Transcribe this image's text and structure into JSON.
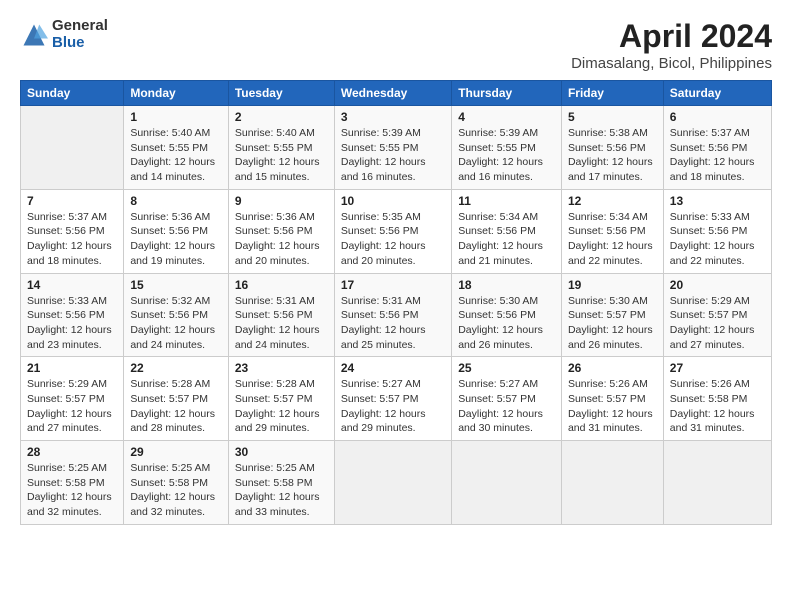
{
  "logo": {
    "general": "General",
    "blue": "Blue"
  },
  "title": "April 2024",
  "subtitle": "Dimasalang, Bicol, Philippines",
  "header": {
    "days": [
      "Sunday",
      "Monday",
      "Tuesday",
      "Wednesday",
      "Thursday",
      "Friday",
      "Saturday"
    ]
  },
  "weeks": [
    [
      {
        "num": "",
        "sunrise": "",
        "sunset": "",
        "daylight": "",
        "empty": true
      },
      {
        "num": "1",
        "sunrise": "Sunrise: 5:40 AM",
        "sunset": "Sunset: 5:55 PM",
        "daylight": "Daylight: 12 hours and 14 minutes.",
        "empty": false
      },
      {
        "num": "2",
        "sunrise": "Sunrise: 5:40 AM",
        "sunset": "Sunset: 5:55 PM",
        "daylight": "Daylight: 12 hours and 15 minutes.",
        "empty": false
      },
      {
        "num": "3",
        "sunrise": "Sunrise: 5:39 AM",
        "sunset": "Sunset: 5:55 PM",
        "daylight": "Daylight: 12 hours and 16 minutes.",
        "empty": false
      },
      {
        "num": "4",
        "sunrise": "Sunrise: 5:39 AM",
        "sunset": "Sunset: 5:55 PM",
        "daylight": "Daylight: 12 hours and 16 minutes.",
        "empty": false
      },
      {
        "num": "5",
        "sunrise": "Sunrise: 5:38 AM",
        "sunset": "Sunset: 5:56 PM",
        "daylight": "Daylight: 12 hours and 17 minutes.",
        "empty": false
      },
      {
        "num": "6",
        "sunrise": "Sunrise: 5:37 AM",
        "sunset": "Sunset: 5:56 PM",
        "daylight": "Daylight: 12 hours and 18 minutes.",
        "empty": false
      }
    ],
    [
      {
        "num": "7",
        "sunrise": "Sunrise: 5:37 AM",
        "sunset": "Sunset: 5:56 PM",
        "daylight": "Daylight: 12 hours and 18 minutes.",
        "empty": false
      },
      {
        "num": "8",
        "sunrise": "Sunrise: 5:36 AM",
        "sunset": "Sunset: 5:56 PM",
        "daylight": "Daylight: 12 hours and 19 minutes.",
        "empty": false
      },
      {
        "num": "9",
        "sunrise": "Sunrise: 5:36 AM",
        "sunset": "Sunset: 5:56 PM",
        "daylight": "Daylight: 12 hours and 20 minutes.",
        "empty": false
      },
      {
        "num": "10",
        "sunrise": "Sunrise: 5:35 AM",
        "sunset": "Sunset: 5:56 PM",
        "daylight": "Daylight: 12 hours and 20 minutes.",
        "empty": false
      },
      {
        "num": "11",
        "sunrise": "Sunrise: 5:34 AM",
        "sunset": "Sunset: 5:56 PM",
        "daylight": "Daylight: 12 hours and 21 minutes.",
        "empty": false
      },
      {
        "num": "12",
        "sunrise": "Sunrise: 5:34 AM",
        "sunset": "Sunset: 5:56 PM",
        "daylight": "Daylight: 12 hours and 22 minutes.",
        "empty": false
      },
      {
        "num": "13",
        "sunrise": "Sunrise: 5:33 AM",
        "sunset": "Sunset: 5:56 PM",
        "daylight": "Daylight: 12 hours and 22 minutes.",
        "empty": false
      }
    ],
    [
      {
        "num": "14",
        "sunrise": "Sunrise: 5:33 AM",
        "sunset": "Sunset: 5:56 PM",
        "daylight": "Daylight: 12 hours and 23 minutes.",
        "empty": false
      },
      {
        "num": "15",
        "sunrise": "Sunrise: 5:32 AM",
        "sunset": "Sunset: 5:56 PM",
        "daylight": "Daylight: 12 hours and 24 minutes.",
        "empty": false
      },
      {
        "num": "16",
        "sunrise": "Sunrise: 5:31 AM",
        "sunset": "Sunset: 5:56 PM",
        "daylight": "Daylight: 12 hours and 24 minutes.",
        "empty": false
      },
      {
        "num": "17",
        "sunrise": "Sunrise: 5:31 AM",
        "sunset": "Sunset: 5:56 PM",
        "daylight": "Daylight: 12 hours and 25 minutes.",
        "empty": false
      },
      {
        "num": "18",
        "sunrise": "Sunrise: 5:30 AM",
        "sunset": "Sunset: 5:56 PM",
        "daylight": "Daylight: 12 hours and 26 minutes.",
        "empty": false
      },
      {
        "num": "19",
        "sunrise": "Sunrise: 5:30 AM",
        "sunset": "Sunset: 5:57 PM",
        "daylight": "Daylight: 12 hours and 26 minutes.",
        "empty": false
      },
      {
        "num": "20",
        "sunrise": "Sunrise: 5:29 AM",
        "sunset": "Sunset: 5:57 PM",
        "daylight": "Daylight: 12 hours and 27 minutes.",
        "empty": false
      }
    ],
    [
      {
        "num": "21",
        "sunrise": "Sunrise: 5:29 AM",
        "sunset": "Sunset: 5:57 PM",
        "daylight": "Daylight: 12 hours and 27 minutes.",
        "empty": false
      },
      {
        "num": "22",
        "sunrise": "Sunrise: 5:28 AM",
        "sunset": "Sunset: 5:57 PM",
        "daylight": "Daylight: 12 hours and 28 minutes.",
        "empty": false
      },
      {
        "num": "23",
        "sunrise": "Sunrise: 5:28 AM",
        "sunset": "Sunset: 5:57 PM",
        "daylight": "Daylight: 12 hours and 29 minutes.",
        "empty": false
      },
      {
        "num": "24",
        "sunrise": "Sunrise: 5:27 AM",
        "sunset": "Sunset: 5:57 PM",
        "daylight": "Daylight: 12 hours and 29 minutes.",
        "empty": false
      },
      {
        "num": "25",
        "sunrise": "Sunrise: 5:27 AM",
        "sunset": "Sunset: 5:57 PM",
        "daylight": "Daylight: 12 hours and 30 minutes.",
        "empty": false
      },
      {
        "num": "26",
        "sunrise": "Sunrise: 5:26 AM",
        "sunset": "Sunset: 5:57 PM",
        "daylight": "Daylight: 12 hours and 31 minutes.",
        "empty": false
      },
      {
        "num": "27",
        "sunrise": "Sunrise: 5:26 AM",
        "sunset": "Sunset: 5:58 PM",
        "daylight": "Daylight: 12 hours and 31 minutes.",
        "empty": false
      }
    ],
    [
      {
        "num": "28",
        "sunrise": "Sunrise: 5:25 AM",
        "sunset": "Sunset: 5:58 PM",
        "daylight": "Daylight: 12 hours and 32 minutes.",
        "empty": false
      },
      {
        "num": "29",
        "sunrise": "Sunrise: 5:25 AM",
        "sunset": "Sunset: 5:58 PM",
        "daylight": "Daylight: 12 hours and 32 minutes.",
        "empty": false
      },
      {
        "num": "30",
        "sunrise": "Sunrise: 5:25 AM",
        "sunset": "Sunset: 5:58 PM",
        "daylight": "Daylight: 12 hours and 33 minutes.",
        "empty": false
      },
      {
        "num": "",
        "sunrise": "",
        "sunset": "",
        "daylight": "",
        "empty": true
      },
      {
        "num": "",
        "sunrise": "",
        "sunset": "",
        "daylight": "",
        "empty": true
      },
      {
        "num": "",
        "sunrise": "",
        "sunset": "",
        "daylight": "",
        "empty": true
      },
      {
        "num": "",
        "sunrise": "",
        "sunset": "",
        "daylight": "",
        "empty": true
      }
    ]
  ]
}
